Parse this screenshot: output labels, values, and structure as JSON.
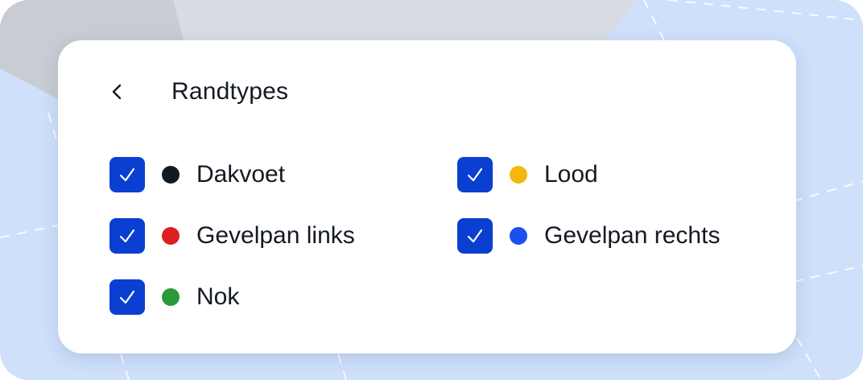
{
  "colors": {
    "map_background": "#cfe0fb",
    "map_gray_area": "#c9ccd3",
    "map_light_area": "#d8dbe3",
    "checkbox": "#0b3fd1",
    "text": "#141a24",
    "panel": "#ffffff"
  },
  "panel": {
    "back_icon": "chevron-left-icon",
    "title": "Randtypes"
  },
  "options": [
    {
      "label": "Dakvoet",
      "checked": true,
      "color": "#141a24",
      "icon": "check-icon"
    },
    {
      "label": "Lood",
      "checked": true,
      "color": "#f5b80a",
      "icon": "check-icon"
    },
    {
      "label": "Gevelpan links",
      "checked": true,
      "color": "#dc1f1f",
      "icon": "check-icon"
    },
    {
      "label": "Gevelpan rechts",
      "checked": true,
      "color": "#1a4ff0",
      "icon": "check-icon"
    },
    {
      "label": "Nok",
      "checked": true,
      "color": "#2a9a3a",
      "icon": "check-icon"
    }
  ]
}
